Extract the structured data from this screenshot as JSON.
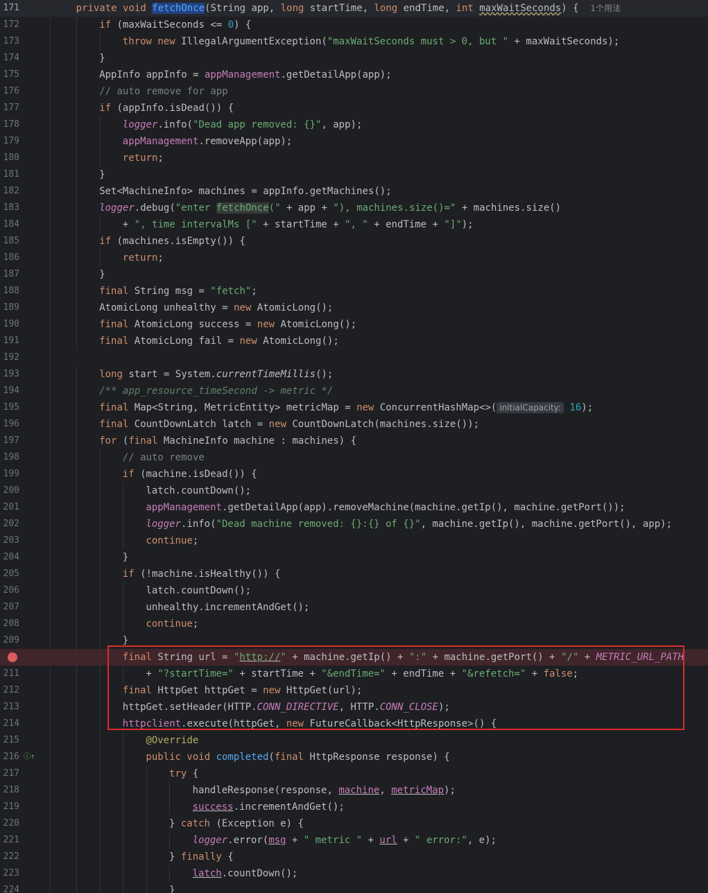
{
  "editor": {
    "usage_hint": "1个用法",
    "inlay_hint_label": "initialCapacity:",
    "accent_colors": {
      "breakpoint": "#db5c5c",
      "highlight_box": "#e02b2b",
      "selection": "#214283"
    }
  },
  "lines": [
    {
      "n": "171",
      "indent": 1,
      "tokens": [
        [
          "kw",
          "private "
        ],
        [
          "kw",
          "void "
        ],
        [
          "fn sel",
          "fetchOnce"
        ],
        [
          "",
          "(String app, "
        ],
        [
          "kw",
          "long "
        ],
        [
          "",
          "startTime, "
        ],
        [
          "kw",
          "long "
        ],
        [
          "",
          "endTime, "
        ],
        [
          "kw",
          "int "
        ],
        [
          "squig",
          "maxWaitSeconds"
        ],
        [
          "",
          ") {  "
        ],
        [
          "usage",
          "1个用法"
        ]
      ]
    },
    {
      "n": "172",
      "indent": 2,
      "tokens": [
        [
          "kw",
          "if "
        ],
        [
          "",
          "(maxWaitSeconds <= "
        ],
        [
          "num",
          "0"
        ],
        [
          "",
          ") {"
        ]
      ]
    },
    {
      "n": "173",
      "indent": 3,
      "tokens": [
        [
          "kw",
          "throw "
        ],
        [
          "kw",
          "new "
        ],
        [
          "",
          "IllegalArgumentException("
        ],
        [
          "str",
          "\"maxWaitSeconds must > 0, but \""
        ],
        [
          "",
          " + maxWaitSeconds);"
        ]
      ]
    },
    {
      "n": "174",
      "indent": 2,
      "tokens": [
        [
          "",
          "}"
        ]
      ]
    },
    {
      "n": "175",
      "indent": 2,
      "tokens": [
        [
          "",
          "AppInfo appInfo = "
        ],
        [
          "fld",
          "appManagement"
        ],
        [
          "",
          ".getDetailApp(app);"
        ]
      ]
    },
    {
      "n": "176",
      "indent": 2,
      "tokens": [
        [
          "cmt",
          "// auto remove for app"
        ]
      ]
    },
    {
      "n": "177",
      "indent": 2,
      "tokens": [
        [
          "kw",
          "if "
        ],
        [
          "",
          "(appInfo.isDead()) {"
        ]
      ]
    },
    {
      "n": "178",
      "indent": 3,
      "tokens": [
        [
          "fld it",
          "logger"
        ],
        [
          "",
          ".info("
        ],
        [
          "str",
          "\"Dead app removed: {}\""
        ],
        [
          "",
          ", app);"
        ]
      ]
    },
    {
      "n": "179",
      "indent": 3,
      "tokens": [
        [
          "fld",
          "appManagement"
        ],
        [
          "",
          ".removeApp(app);"
        ]
      ]
    },
    {
      "n": "180",
      "indent": 3,
      "tokens": [
        [
          "kw",
          "return"
        ],
        [
          "",
          ";"
        ]
      ]
    },
    {
      "n": "181",
      "indent": 2,
      "tokens": [
        [
          "",
          "}"
        ]
      ]
    },
    {
      "n": "182",
      "indent": 2,
      "tokens": [
        [
          "",
          "Set<MachineInfo> machines = appInfo.getMachines();"
        ]
      ]
    },
    {
      "n": "183",
      "indent": 2,
      "tokens": [
        [
          "fld it",
          "logger"
        ],
        [
          "",
          ".debug("
        ],
        [
          "str",
          "\"enter "
        ],
        [
          "str occ",
          "fetchOnce"
        ],
        [
          "str",
          "(\""
        ],
        [
          "",
          " + app + "
        ],
        [
          "str",
          "\"), machines.size()=\""
        ],
        [
          "",
          " + machines.size()"
        ]
      ]
    },
    {
      "n": "184",
      "indent": 3,
      "tokens": [
        [
          "",
          "+ "
        ],
        [
          "str",
          "\", time intervalMs [\""
        ],
        [
          "",
          " + startTime + "
        ],
        [
          "str",
          "\", \""
        ],
        [
          "",
          " + endTime + "
        ],
        [
          "str",
          "\"]\""
        ],
        [
          "",
          ");"
        ]
      ]
    },
    {
      "n": "185",
      "indent": 2,
      "tokens": [
        [
          "kw",
          "if "
        ],
        [
          "",
          "(machines.isEmpty()) {"
        ]
      ]
    },
    {
      "n": "186",
      "indent": 3,
      "tokens": [
        [
          "kw",
          "return"
        ],
        [
          "",
          ";"
        ]
      ]
    },
    {
      "n": "187",
      "indent": 2,
      "tokens": [
        [
          "",
          "}"
        ]
      ]
    },
    {
      "n": "188",
      "indent": 2,
      "tokens": [
        [
          "kw",
          "final "
        ],
        [
          "",
          "String msg = "
        ],
        [
          "str",
          "\"fetch\""
        ],
        [
          "",
          ";"
        ]
      ]
    },
    {
      "n": "189",
      "indent": 2,
      "tokens": [
        [
          "",
          "AtomicLong unhealthy = "
        ],
        [
          "kw",
          "new "
        ],
        [
          "",
          "AtomicLong();"
        ]
      ]
    },
    {
      "n": "190",
      "indent": 2,
      "tokens": [
        [
          "kw",
          "final "
        ],
        [
          "",
          "AtomicLong success = "
        ],
        [
          "kw",
          "new "
        ],
        [
          "",
          "AtomicLong();"
        ]
      ]
    },
    {
      "n": "191",
      "indent": 2,
      "tokens": [
        [
          "kw",
          "final "
        ],
        [
          "",
          "AtomicLong fail = "
        ],
        [
          "kw",
          "new "
        ],
        [
          "",
          "AtomicLong();"
        ]
      ]
    },
    {
      "n": "192",
      "indent": 0,
      "tokens": []
    },
    {
      "n": "193",
      "indent": 2,
      "tokens": [
        [
          "kw",
          "long "
        ],
        [
          "",
          "start = System."
        ],
        [
          "it",
          "currentTimeMillis"
        ],
        [
          "",
          "();"
        ]
      ]
    },
    {
      "n": "194",
      "indent": 2,
      "tokens": [
        [
          "doc",
          "/** app_resource_timeSecond -> metric */"
        ]
      ]
    },
    {
      "n": "195",
      "indent": 2,
      "tokens": [
        [
          "kw",
          "final "
        ],
        [
          "",
          "Map<String, MetricEntity> metricMap = "
        ],
        [
          "kw",
          "new "
        ],
        [
          "",
          "ConcurrentHashMap<>("
        ],
        [
          "tag",
          "initialCapacity:"
        ],
        [
          "num",
          " 16"
        ],
        [
          "",
          ");"
        ]
      ]
    },
    {
      "n": "196",
      "indent": 2,
      "tokens": [
        [
          "kw",
          "final "
        ],
        [
          "",
          "CountDownLatch latch = "
        ],
        [
          "kw",
          "new "
        ],
        [
          "",
          "CountDownLatch(machines.size());"
        ]
      ]
    },
    {
      "n": "197",
      "indent": 2,
      "tokens": [
        [
          "kw",
          "for "
        ],
        [
          "",
          "("
        ],
        [
          "kw",
          "final "
        ],
        [
          "",
          "MachineInfo machine : machines) {"
        ]
      ]
    },
    {
      "n": "198",
      "indent": 3,
      "tokens": [
        [
          "cmt",
          "// auto remove"
        ]
      ]
    },
    {
      "n": "199",
      "indent": 3,
      "tokens": [
        [
          "kw",
          "if "
        ],
        [
          "",
          "(machine.isDead()) {"
        ]
      ]
    },
    {
      "n": "200",
      "indent": 4,
      "tokens": [
        [
          "",
          "latch.countDown();"
        ]
      ]
    },
    {
      "n": "201",
      "indent": 4,
      "tokens": [
        [
          "fld",
          "appManagement"
        ],
        [
          "",
          ".getDetailApp(app).removeMachine(machine.getIp(), machine.getPort());"
        ]
      ]
    },
    {
      "n": "202",
      "indent": 4,
      "tokens": [
        [
          "fld it",
          "logger"
        ],
        [
          "",
          ".info("
        ],
        [
          "str",
          "\"Dead machine removed: {}:{} of {}\""
        ],
        [
          "",
          ", machine.getIp(), machine.getPort(), app);"
        ]
      ]
    },
    {
      "n": "203",
      "indent": 4,
      "tokens": [
        [
          "kw",
          "continue"
        ],
        [
          "",
          ";"
        ]
      ]
    },
    {
      "n": "204",
      "indent": 3,
      "tokens": [
        [
          "",
          "}"
        ]
      ]
    },
    {
      "n": "205",
      "indent": 3,
      "tokens": [
        [
          "kw",
          "if "
        ],
        [
          "",
          "(!machine.isHealthy()) {"
        ]
      ]
    },
    {
      "n": "206",
      "indent": 4,
      "tokens": [
        [
          "",
          "latch.countDown();"
        ]
      ]
    },
    {
      "n": "207",
      "indent": 4,
      "tokens": [
        [
          "",
          "unhealthy.incrementAndGet();"
        ]
      ]
    },
    {
      "n": "208",
      "indent": 4,
      "tokens": [
        [
          "kw",
          "continue"
        ],
        [
          "",
          ";"
        ]
      ]
    },
    {
      "n": "209",
      "indent": 3,
      "tokens": [
        [
          "",
          "}"
        ]
      ]
    },
    {
      "n": "",
      "indent": 3,
      "tokens": [
        [
          "kw",
          "final "
        ],
        [
          "",
          "String url = "
        ],
        [
          "str",
          "\""
        ],
        [
          "str ul",
          "http://"
        ],
        [
          "str",
          "\""
        ],
        [
          "",
          " + machine.getIp() + "
        ],
        [
          "str",
          "\":\""
        ],
        [
          "",
          " + machine.getPort() + "
        ],
        [
          "str",
          "\"/\""
        ],
        [
          "",
          " + "
        ],
        [
          "fld it",
          "METRIC_URL_PATH"
        ]
      ]
    },
    {
      "n": "211",
      "indent": 4,
      "tokens": [
        [
          "",
          "+ "
        ],
        [
          "str",
          "\"?startTime=\""
        ],
        [
          "",
          " + startTime + "
        ],
        [
          "str",
          "\"&endTime=\""
        ],
        [
          "",
          " + endTime + "
        ],
        [
          "str",
          "\"&refetch=\""
        ],
        [
          "",
          " + "
        ],
        [
          "kw",
          "false"
        ],
        [
          "",
          ";"
        ]
      ]
    },
    {
      "n": "212",
      "indent": 3,
      "tokens": [
        [
          "kw",
          "final "
        ],
        [
          "",
          "HttpGet httpGet = "
        ],
        [
          "kw",
          "new "
        ],
        [
          "",
          "HttpGet(url);"
        ]
      ]
    },
    {
      "n": "213",
      "indent": 3,
      "tokens": [
        [
          "",
          "httpGet.setHeader(HTTP."
        ],
        [
          "fld it",
          "CONN_DIRECTIVE"
        ],
        [
          "",
          ", HTTP."
        ],
        [
          "fld it",
          "CONN_CLOSE"
        ],
        [
          "",
          ");"
        ]
      ]
    },
    {
      "n": "214",
      "indent": 3,
      "tokens": [
        [
          "fld",
          "httpclient"
        ],
        [
          "",
          ".execute(httpGet, "
        ],
        [
          "kw",
          "new "
        ],
        [
          "",
          "FutureCallback<HttpResponse>() {"
        ]
      ]
    },
    {
      "n": "215",
      "indent": 4,
      "tokens": [
        [
          "ann",
          "@Override"
        ]
      ]
    },
    {
      "n": "216",
      "indent": 4,
      "tokens": [
        [
          "kw",
          "public "
        ],
        [
          "kw",
          "void "
        ],
        [
          "fn",
          "completed"
        ],
        [
          "",
          "("
        ],
        [
          "kw",
          "final "
        ],
        [
          "",
          "HttpResponse response) {"
        ]
      ]
    },
    {
      "n": "217",
      "indent": 5,
      "tokens": [
        [
          "kw",
          "try "
        ],
        [
          "",
          "{"
        ]
      ]
    },
    {
      "n": "218",
      "indent": 6,
      "tokens": [
        [
          "",
          "handleResponse(response, "
        ],
        [
          "fld ul",
          "machine"
        ],
        [
          "",
          ", "
        ],
        [
          "fld ul",
          "metricMap"
        ],
        [
          "",
          ");"
        ]
      ]
    },
    {
      "n": "219",
      "indent": 6,
      "tokens": [
        [
          "fld ul",
          "success"
        ],
        [
          "",
          ".incrementAndGet();"
        ]
      ]
    },
    {
      "n": "220",
      "indent": 5,
      "tokens": [
        [
          "",
          "} "
        ],
        [
          "kw",
          "catch "
        ],
        [
          "",
          "(Exception e) {"
        ]
      ]
    },
    {
      "n": "221",
      "indent": 6,
      "tokens": [
        [
          "fld it",
          "logger"
        ],
        [
          "",
          ".error("
        ],
        [
          "fld ul",
          "msg"
        ],
        [
          "",
          " + "
        ],
        [
          "str",
          "\" metric \""
        ],
        [
          "",
          " + "
        ],
        [
          "fld ul",
          "url"
        ],
        [
          "",
          " + "
        ],
        [
          "str",
          "\" error:\""
        ],
        [
          "",
          ", e);"
        ]
      ]
    },
    {
      "n": "222",
      "indent": 5,
      "tokens": [
        [
          "",
          "} "
        ],
        [
          "kw",
          "finally "
        ],
        [
          "",
          "{"
        ]
      ]
    },
    {
      "n": "223",
      "indent": 6,
      "tokens": [
        [
          "fld ul",
          "latch"
        ],
        [
          "",
          ".countDown();"
        ]
      ]
    },
    {
      "n": "224",
      "indent": 5,
      "tokens": [
        [
          "",
          "}"
        ]
      ]
    }
  ]
}
